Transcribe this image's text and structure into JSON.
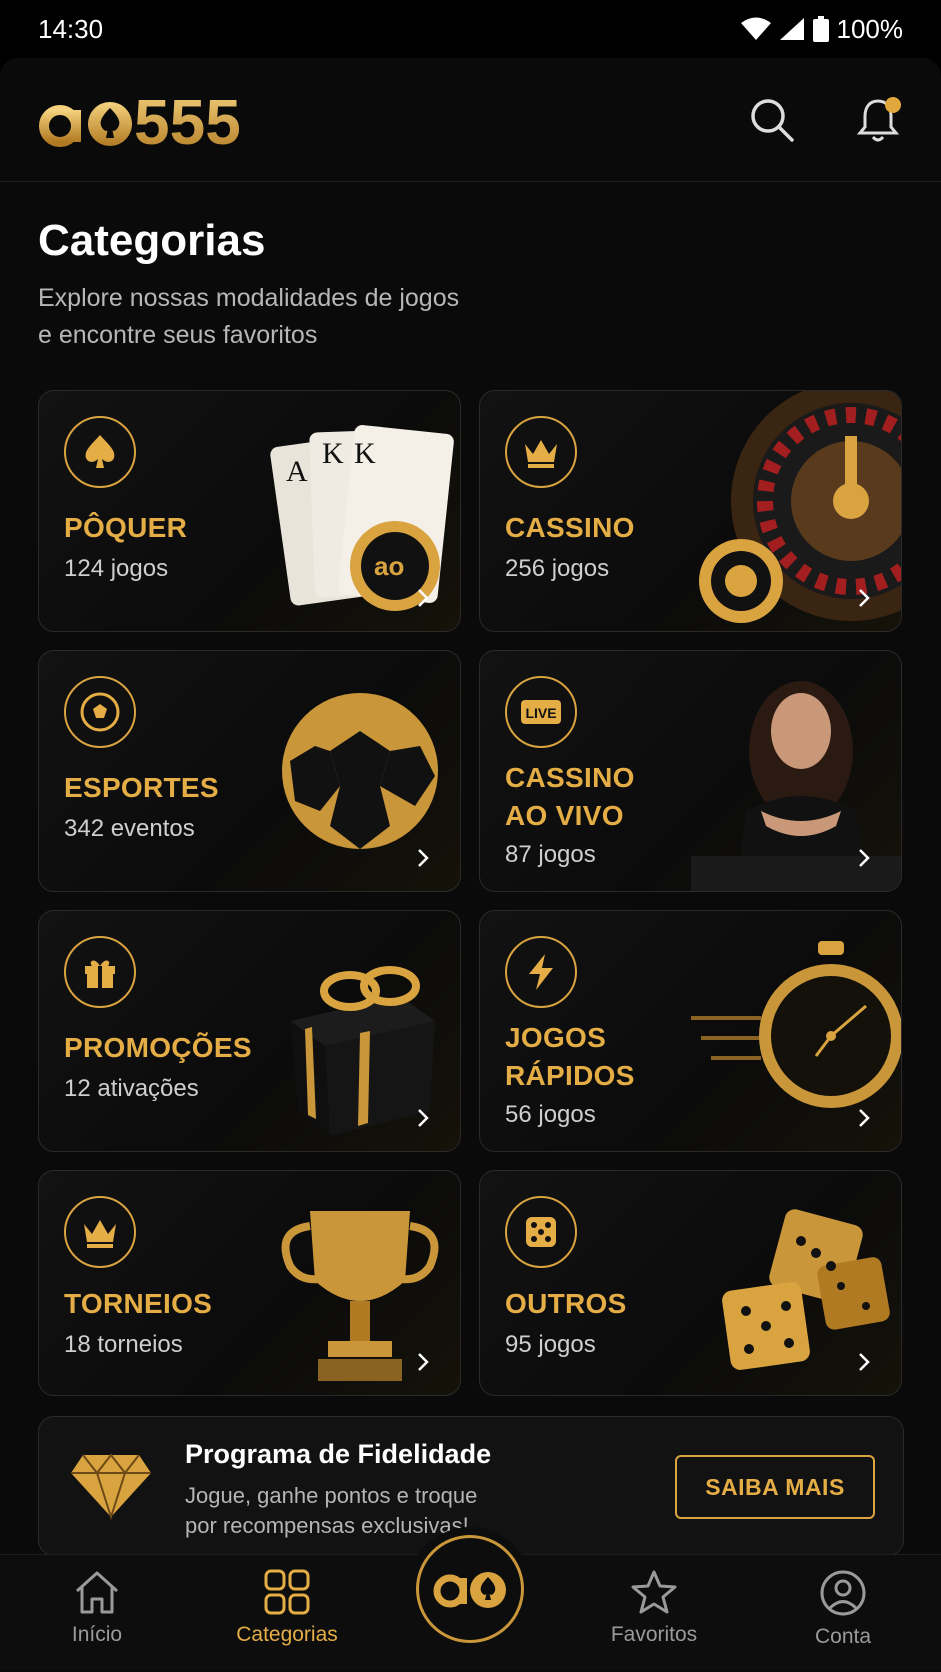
{
  "status_bar": {
    "time": "14:30",
    "battery": "100%"
  },
  "header": {
    "logo_text": "ao555",
    "search_icon": "search-icon",
    "notification_icon": "bell-icon",
    "accent_color": "#e4ad45"
  },
  "page": {
    "title": "Categorias",
    "subtitle_line1": "Explore nossas modalidades de jogos",
    "subtitle_line2": "e encontre seus favoritos"
  },
  "categories": [
    {
      "title": "PÔQUER",
      "count": "124 jogos",
      "icon": "spade-icon"
    },
    {
      "title": "CASSINO",
      "count": "256 jogos",
      "icon": "crown-icon"
    },
    {
      "title": "ESPORTES",
      "count": "342 eventos",
      "icon": "soccer-ball-icon"
    },
    {
      "title_line1": "CASSINO",
      "title_line2": "AO VIVO",
      "count": "87 jogos",
      "icon": "live-icon",
      "icon_text": "LIVE"
    },
    {
      "title": "PROMOÇÕES",
      "count": "12 ativações",
      "icon": "gift-icon"
    },
    {
      "title_line1": "JOGOS",
      "title_line2": "RÁPIDOS",
      "count": "56 jogos",
      "icon": "lightning-icon"
    },
    {
      "title": "TORNEIOS",
      "count": "18 torneios",
      "icon": "crown-icon"
    },
    {
      "title": "OUTROS",
      "count": "95 jogos",
      "icon": "dice-icon"
    }
  ],
  "loyalty": {
    "title": "Programa de Fidelidade",
    "desc_line1": "Jogue, ganhe pontos e troque",
    "desc_line2": "por recompensas exclusivas!",
    "button": "SAIBA MAIS"
  },
  "bottom_nav": [
    {
      "label": "Início",
      "icon": "home-icon"
    },
    {
      "label": "Categorias",
      "icon": "grid-icon",
      "active": true
    },
    {
      "label": "Favoritos",
      "icon": "star-icon"
    },
    {
      "label": "Conta",
      "icon": "user-icon"
    }
  ]
}
